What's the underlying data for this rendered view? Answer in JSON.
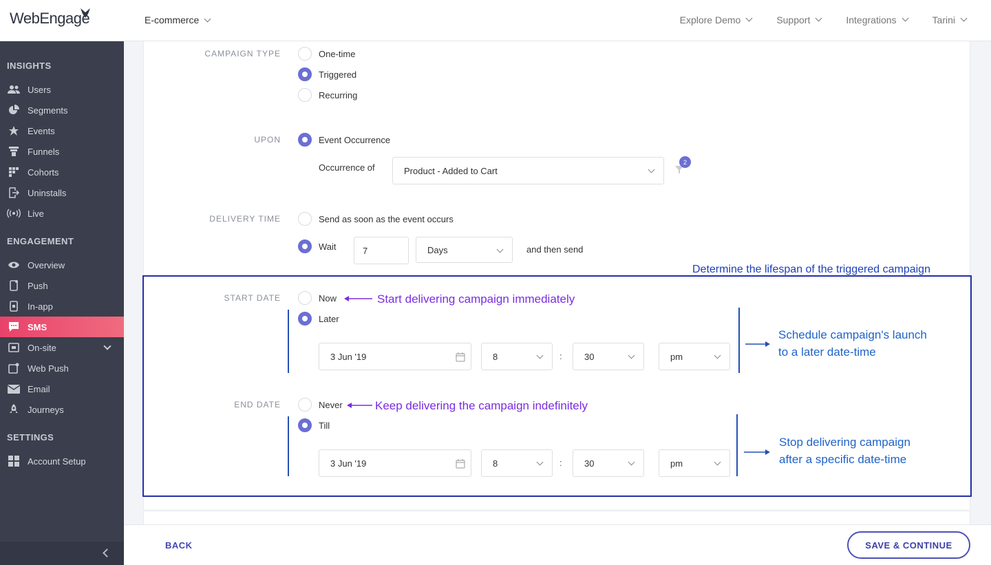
{
  "header": {
    "logo": "WebEngage",
    "project": "E-commerce",
    "nav": [
      "Explore Demo",
      "Support",
      "Integrations",
      "Tarini"
    ]
  },
  "sidebar": {
    "sections": [
      {
        "title": "INSIGHTS",
        "items": [
          {
            "label": "Users",
            "icon": "users-icon"
          },
          {
            "label": "Segments",
            "icon": "pie-chart-icon"
          },
          {
            "label": "Events",
            "icon": "star-icon"
          },
          {
            "label": "Funnels",
            "icon": "funnel-icon"
          },
          {
            "label": "Cohorts",
            "icon": "grid-icon"
          },
          {
            "label": "Uninstalls",
            "icon": "exit-icon"
          },
          {
            "label": "Live",
            "icon": "broadcast-icon"
          }
        ]
      },
      {
        "title": "ENGAGEMENT",
        "items": [
          {
            "label": "Overview",
            "icon": "eye-icon"
          },
          {
            "label": "Push",
            "icon": "phone-icon"
          },
          {
            "label": "In-app",
            "icon": "tablet-icon"
          },
          {
            "label": "SMS",
            "icon": "chat-icon",
            "active": true
          },
          {
            "label": "On-site",
            "icon": "browser-icon"
          },
          {
            "label": "Web Push",
            "icon": "webpush-icon"
          },
          {
            "label": "Email",
            "icon": "envelope-icon"
          },
          {
            "label": "Journeys",
            "icon": "rocket-icon"
          }
        ]
      },
      {
        "title": "SETTINGS",
        "items": [
          {
            "label": "Account Setup",
            "icon": "apps-icon"
          }
        ]
      }
    ]
  },
  "form": {
    "campaign_type": {
      "label": "CAMPAIGN TYPE",
      "options": [
        "One-time",
        "Triggered",
        "Recurring"
      ],
      "selected": "Triggered"
    },
    "upon": {
      "label": "UPON",
      "option": "Event Occurrence",
      "occurrence_label": "Occurrence of",
      "event": "Product - Added to Cart",
      "filter_count": "2"
    },
    "delivery_time": {
      "label": "DELIVERY TIME",
      "options": [
        "Send as soon as the event occurs",
        "Wait"
      ],
      "selected": "Wait",
      "wait_value": "7",
      "wait_unit": "Days",
      "suffix": "and then send"
    },
    "start_date": {
      "label": "START DATE",
      "options": [
        "Now",
        "Later"
      ],
      "selected": "Later",
      "date": "3 Jun '19",
      "hour": "8",
      "minute": "30",
      "ampm": "pm"
    },
    "end_date": {
      "label": "END DATE",
      "options": [
        "Never",
        "Till"
      ],
      "selected": "Till",
      "date": "3 Jun '19",
      "hour": "8",
      "minute": "30",
      "ampm": "pm"
    },
    "colon": ":"
  },
  "annotations": {
    "header": "Determine the lifespan of the triggered campaign",
    "now": "Start delivering campaign immediately",
    "later_1": "Schedule campaign's launch",
    "later_2": "to a later date-time",
    "never": "Keep delivering the campaign indefinitely",
    "till_1": "Stop delivering campaign",
    "till_2": "after a specific date-time",
    "purple": "#7a2de0",
    "blue": "#1f63c8"
  },
  "footer": {
    "back": "BACK",
    "save": "SAVE & CONTINUE"
  },
  "colors": {
    "accent": "#6b6fd4",
    "active_nav": "#e9426a",
    "sidebar": "#3b3e4c"
  }
}
